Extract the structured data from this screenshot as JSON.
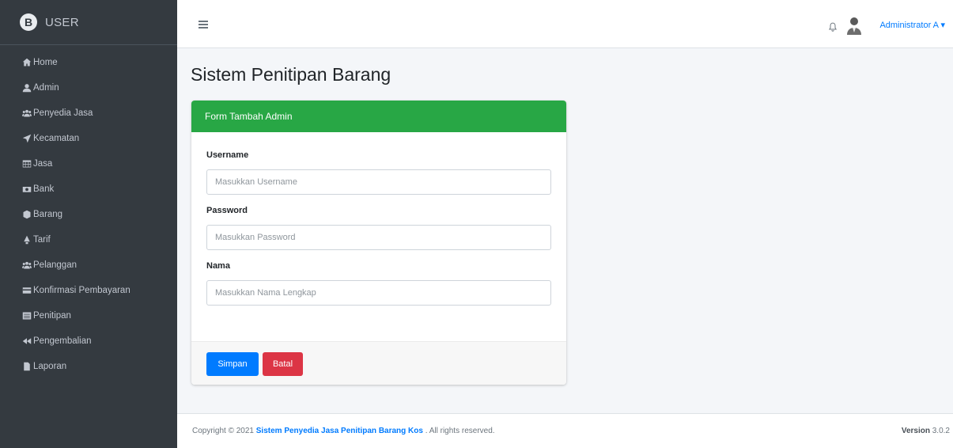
{
  "sidebar": {
    "brand": "USER",
    "items": [
      {
        "label": "Home",
        "icon": "home-icon"
      },
      {
        "label": "Admin",
        "icon": "user-icon"
      },
      {
        "label": "Penyedia Jasa",
        "icon": "users-icon"
      },
      {
        "label": "Kecamatan",
        "icon": "location-arrow-icon"
      },
      {
        "label": "Jasa",
        "icon": "table-icon"
      },
      {
        "label": "Bank",
        "icon": "money-icon"
      },
      {
        "label": "Barang",
        "icon": "box-icon"
      },
      {
        "label": "Tarif",
        "icon": "tag-icon"
      },
      {
        "label": "Pelanggan",
        "icon": "users-icon"
      },
      {
        "label": "Konfirmasi Pembayaran",
        "icon": "credit-card-icon"
      },
      {
        "label": "Penitipan",
        "icon": "list-icon"
      },
      {
        "label": "Pengembalian",
        "icon": "backward-icon"
      },
      {
        "label": "Laporan",
        "icon": "file-icon"
      }
    ]
  },
  "header": {
    "user_name": "Administrator A"
  },
  "page": {
    "title": "Sistem Penitipan Barang"
  },
  "form": {
    "header": "Form Tambah Admin",
    "username_label": "Username",
    "username_placeholder": "Masukkan Username",
    "password_label": "Password",
    "password_placeholder": "Masukkan Password",
    "nama_label": "Nama",
    "nama_placeholder": "Masukkan Nama Lengkap",
    "save_label": "Simpan",
    "cancel_label": "Batal"
  },
  "footer": {
    "copyright_prefix": "Copyright © 2021 ",
    "link_text": "Sistem Penyedia Jasa Penitipan Barang Kos",
    "rights_text": " . All rights reserved.",
    "version_label": "Version",
    "version_value": "3.0.2"
  },
  "colors": {
    "sidebar": "#343a40",
    "success": "#28a745",
    "primary": "#007bff",
    "danger": "#dc3545"
  }
}
